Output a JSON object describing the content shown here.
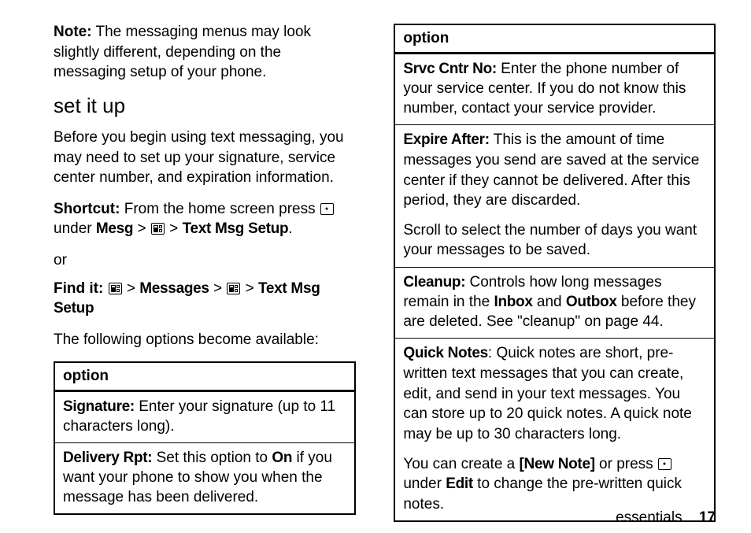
{
  "col1": {
    "note_label": "Note:",
    "note_text": " The messaging menus may look slightly different, depending on the messaging setup of your phone.",
    "heading": "set it up",
    "intro": "Before you begin using text messaging, you may need to set up your signature, service center number, and expiration information.",
    "shortcut_label": "Shortcut:",
    "shortcut_text1": " From the home screen press ",
    "shortcut_text2": " under ",
    "shortcut_mesg": "Mesg",
    "shortcut_gt1": " > ",
    "shortcut_gt2": " > ",
    "shortcut_tms": "Text Msg Setup",
    "shortcut_period": ".",
    "or": "or",
    "findit_label": "Find it:",
    "findit_sp": " ",
    "findit_gt1": " > ",
    "findit_messages": "Messages",
    "findit_gt2": " > ",
    "findit_gt3": " > ",
    "findit_tms": "Text Msg Setup",
    "following": "The following options become available:",
    "table_header": "option",
    "row1_label": "Signature:",
    "row1_text": " Enter your signature (up to 11 characters long).",
    "row2_label": "Delivery Rpt:",
    "row2_text1": " Set this option to ",
    "row2_on": "On",
    "row2_text2": " if you want your phone to show you when the message has been delivered."
  },
  "col2": {
    "table_header": "option",
    "r1_label": "Srvc Cntr No:",
    "r1_text": " Enter the phone number of your service center. If you do not know this number, contact your service provider.",
    "r2_label": "Expire After:",
    "r2_text1": " This is the amount of time messages you send are saved at the service center if they cannot be delivered. After this period, they are discarded.",
    "r2_text2": "Scroll to select the number of days you want your messages to be saved.",
    "r3_label": "Cleanup:",
    "r3_text1": " Controls how long messages remain in the ",
    "r3_inbox": "Inbox",
    "r3_and": " and ",
    "r3_outbox": "Outbox",
    "r3_text2": " before they are deleted. See \"cleanup\" on page 44.",
    "r4_label": "Quick Notes",
    "r4_text1": ": Quick notes are short, pre-written text messages that you can create, edit, and send in your text messages. You can store up to 20 quick notes. A quick note may be up to 30 characters long.",
    "r4_text2a": "You can create a ",
    "r4_newnote": "[New Note]",
    "r4_text2b": " or press ",
    "r4_text2c": " under ",
    "r4_edit": "Edit",
    "r4_text2d": " to change the pre-written quick notes."
  },
  "footer": {
    "section": "essentials",
    "page": "17"
  }
}
